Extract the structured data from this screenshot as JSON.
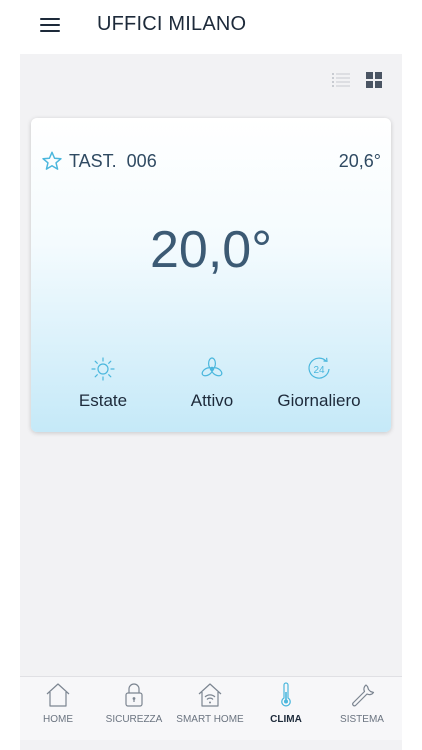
{
  "header": {
    "title": "UFFICI MILANO",
    "menu_icon": "hamburger-icon"
  },
  "view_toggle": {
    "list_icon": "list-view-icon",
    "grid_icon": "grid-view-icon",
    "selected": "grid"
  },
  "thermostat": {
    "name": "TAST.  006",
    "ambient_temperature": "20,6°",
    "setpoint": "20,0°",
    "favorite": false,
    "modes": [
      {
        "id": "season",
        "icon": "sun-icon",
        "label": "Estate"
      },
      {
        "id": "fan",
        "icon": "fan-icon",
        "label": "Attivo"
      },
      {
        "id": "schedule",
        "icon": "24h-icon",
        "label": "Giornaliero"
      }
    ]
  },
  "tabs": [
    {
      "id": "home",
      "icon": "house-icon",
      "label": "HOME",
      "active": false
    },
    {
      "id": "security",
      "icon": "lock-icon",
      "label": "SICUREZZA",
      "active": false
    },
    {
      "id": "smarthome",
      "icon": "smart-home-icon",
      "label": "SMART HOME",
      "active": false
    },
    {
      "id": "climate",
      "icon": "thermometer-icon",
      "label": "CLIMA",
      "active": true
    },
    {
      "id": "system",
      "icon": "wrench-icon",
      "label": "SISTEMA",
      "active": false
    }
  ],
  "colors": {
    "accent": "#4bb7dd",
    "text": "#1d2a3a",
    "card_gradient_bottom": "#c5e9f8"
  }
}
